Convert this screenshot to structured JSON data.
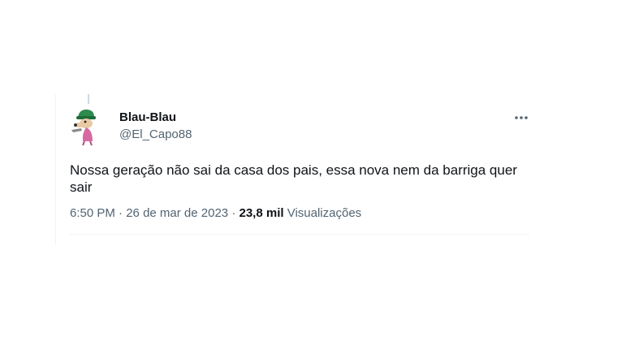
{
  "tweet": {
    "display_name": "Blau-Blau",
    "handle": "@El_Capo88",
    "text": "Nossa geração não sai da casa dos pais, essa nova nem da barriga quer sair",
    "time": "6:50 PM",
    "separator": "·",
    "date": "26 de mar de 2023",
    "views_count": "23,8 mil",
    "views_label": "Visualizações",
    "more_icon": "more-horizontal-icon",
    "avatar_icon": "cartoon-avatar"
  },
  "colors": {
    "text_primary": "#0f1419",
    "text_secondary": "#536471",
    "divider": "#eff3f4"
  }
}
